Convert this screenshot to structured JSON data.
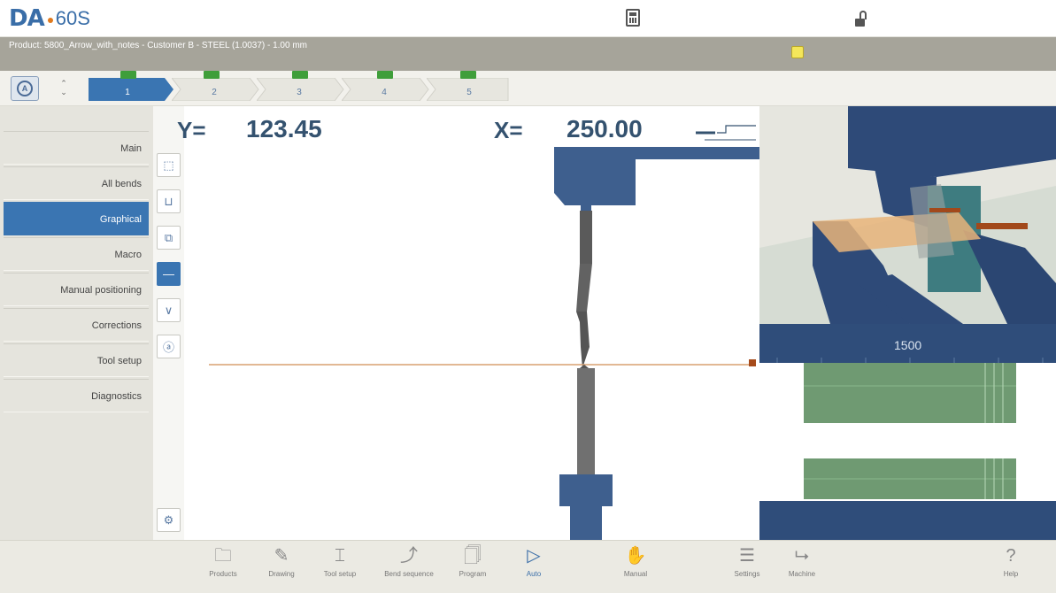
{
  "app": {
    "brand": "DA",
    "model": "60S"
  },
  "product": {
    "title": "Product: 5800_Arrow_with_notes - Customer B - STEEL (1.0037) - 1.00 mm"
  },
  "steps": [
    {
      "num": "1",
      "active": true
    },
    {
      "num": "2",
      "active": false
    },
    {
      "num": "3",
      "active": false
    },
    {
      "num": "4",
      "active": false
    },
    {
      "num": "5",
      "active": false
    }
  ],
  "nav": {
    "items": [
      {
        "label": "Main"
      },
      {
        "label": "All bends"
      },
      {
        "label": "Graphical",
        "active": true
      },
      {
        "label": "Macro"
      },
      {
        "label": "Manual positioning"
      },
      {
        "label": "Corrections"
      },
      {
        "label": "Tool setup"
      },
      {
        "label": "Diagnostics"
      }
    ]
  },
  "graphics": {
    "y_label": "Y=",
    "y_value": "123.45",
    "x_label": "X=",
    "x_value": "250.00"
  },
  "topview": {
    "value": "1500"
  },
  "bottom": {
    "items": [
      {
        "label": "Products",
        "icon": "folder-icon"
      },
      {
        "label": "Drawing",
        "icon": "pencil-icon"
      },
      {
        "label": "Tool setup",
        "icon": "tool-setup-icon"
      },
      {
        "label": "Bend sequence",
        "icon": "bend-sequence-icon"
      },
      {
        "label": "Program",
        "icon": "program-icon"
      },
      {
        "label": "Auto",
        "icon": "play-icon",
        "active": true
      },
      {
        "label": "Manual",
        "icon": "hand-icon"
      },
      {
        "label": "Settings",
        "icon": "list-icon"
      },
      {
        "label": "Machine",
        "icon": "machine-icon"
      },
      {
        "label": "Help",
        "icon": "help-icon"
      }
    ]
  },
  "colors": {
    "accent": "#3a75b2",
    "machine": "#3e5f8e",
    "sheet": "#e2b57c",
    "badge": "#3f9e3a"
  }
}
